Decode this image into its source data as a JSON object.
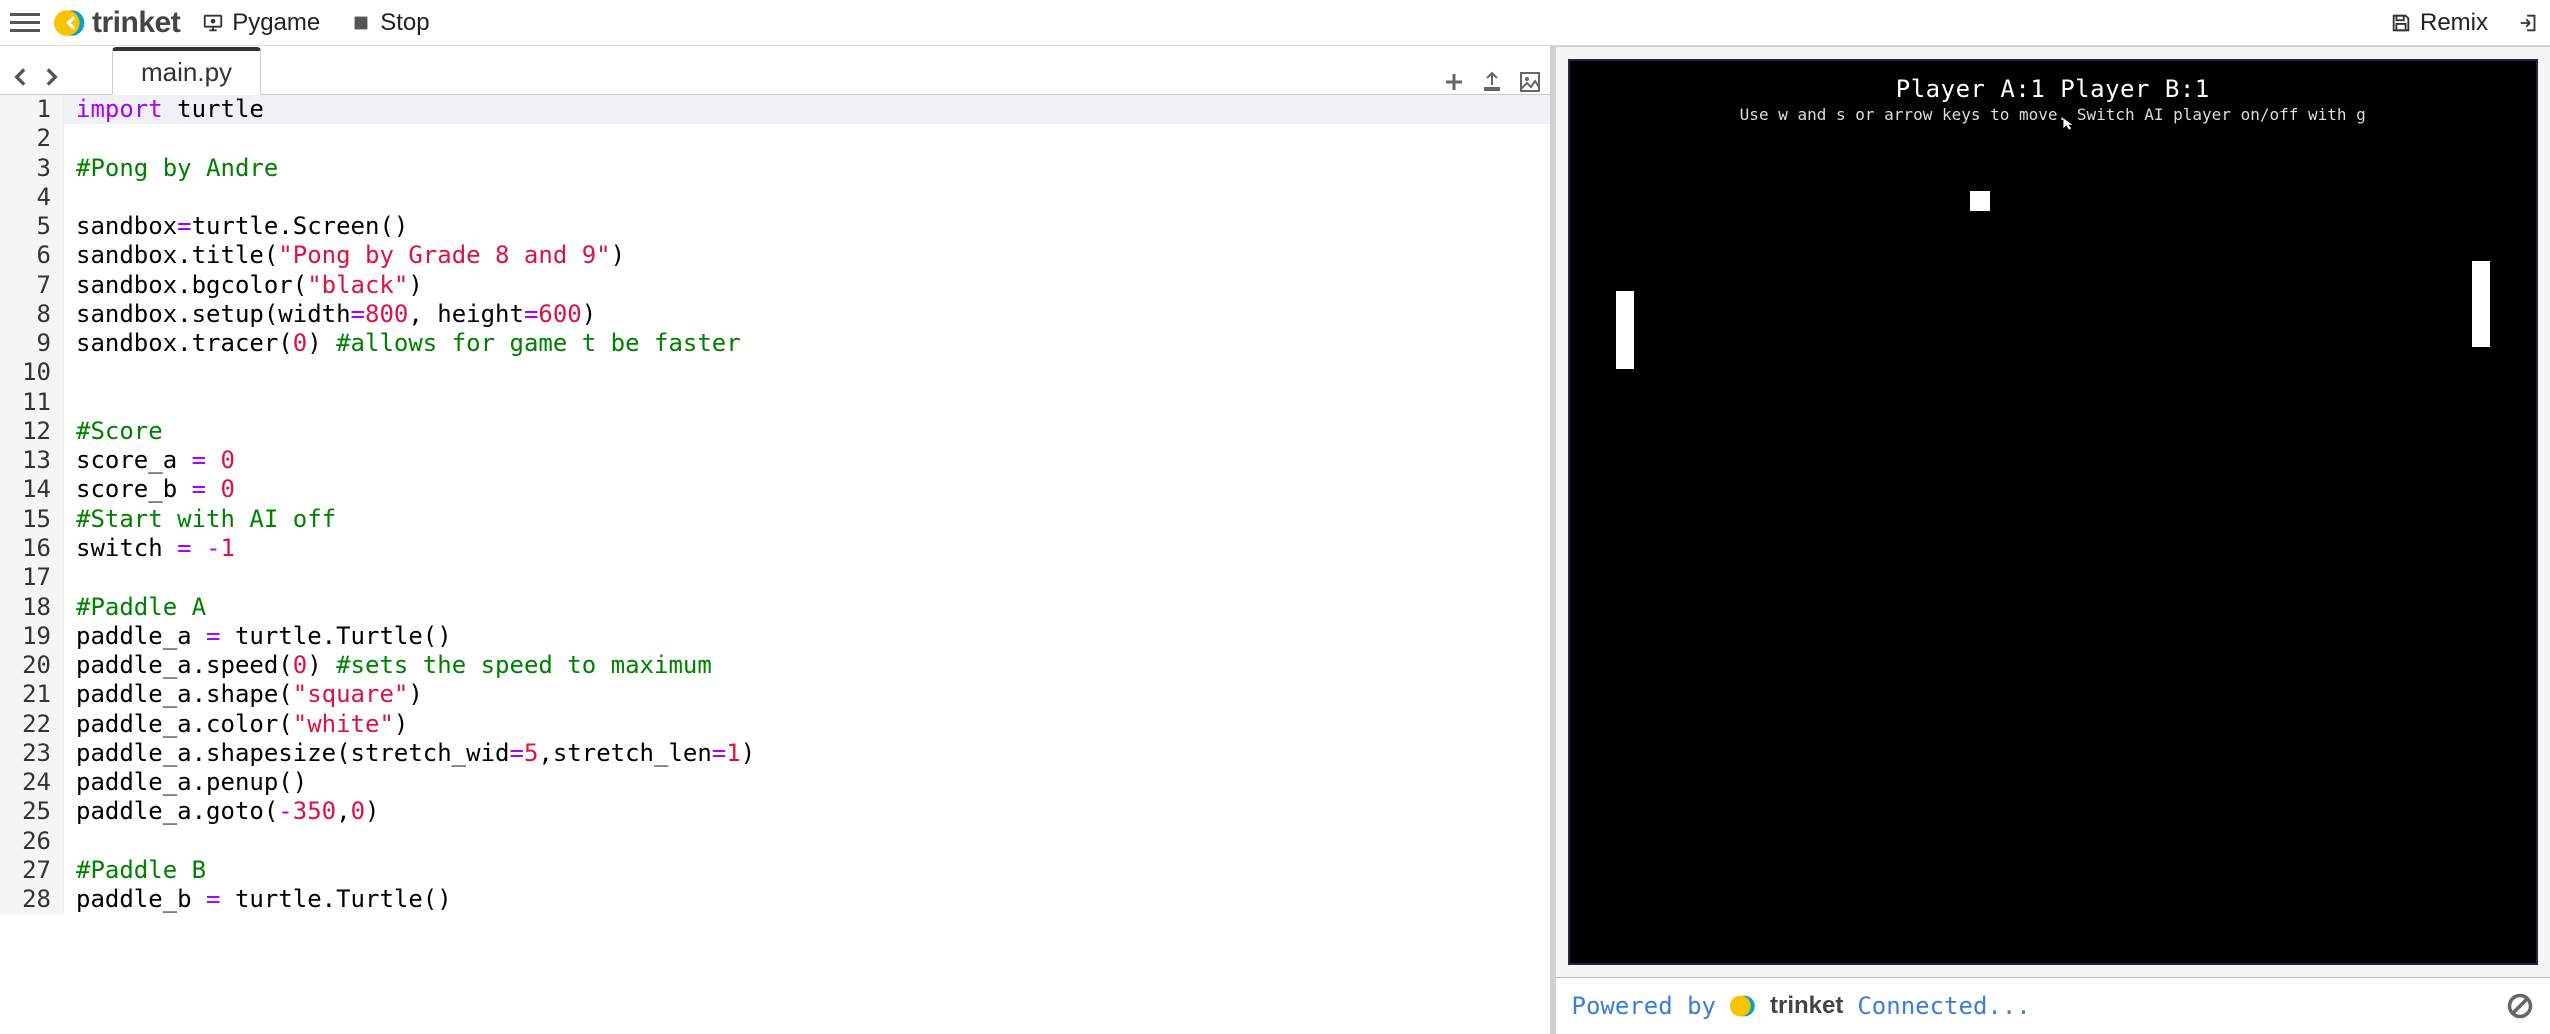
{
  "toolbar": {
    "brand": "trinket",
    "mode_label": "Pygame",
    "stop_label": "Stop",
    "remix_label": "Remix"
  },
  "editor": {
    "active_tab_filename": "main.py",
    "lines": [
      {
        "n": 1,
        "active": true,
        "tokens": [
          [
            "kw",
            "import"
          ],
          [
            "sp",
            " "
          ],
          [
            "nm",
            "turtle"
          ]
        ]
      },
      {
        "n": 2,
        "tokens": []
      },
      {
        "n": 3,
        "tokens": [
          [
            "com",
            "#Pong by Andre"
          ]
        ]
      },
      {
        "n": 4,
        "tokens": []
      },
      {
        "n": 5,
        "tokens": [
          [
            "nm",
            "sandbox"
          ],
          [
            "op",
            "="
          ],
          [
            "nm",
            "turtle.Screen()"
          ]
        ]
      },
      {
        "n": 6,
        "tokens": [
          [
            "nm",
            "sandbox.title("
          ],
          [
            "str",
            "\"Pong by Grade 8 and 9\""
          ],
          [
            "nm",
            ")"
          ]
        ]
      },
      {
        "n": 7,
        "tokens": [
          [
            "nm",
            "sandbox.bgcolor("
          ],
          [
            "str",
            "\"black\""
          ],
          [
            "nm",
            ")"
          ]
        ]
      },
      {
        "n": 8,
        "tokens": [
          [
            "nm",
            "sandbox.setup(width"
          ],
          [
            "op",
            "="
          ],
          [
            "num",
            "800"
          ],
          [
            "nm",
            ", height"
          ],
          [
            "op",
            "="
          ],
          [
            "num",
            "600"
          ],
          [
            "nm",
            ")"
          ]
        ]
      },
      {
        "n": 9,
        "tokens": [
          [
            "nm",
            "sandbox.tracer("
          ],
          [
            "num",
            "0"
          ],
          [
            "nm",
            ") "
          ],
          [
            "com",
            "#allows for game t be faster"
          ]
        ]
      },
      {
        "n": 10,
        "tokens": []
      },
      {
        "n": 11,
        "tokens": []
      },
      {
        "n": 12,
        "tokens": [
          [
            "com",
            "#Score"
          ]
        ]
      },
      {
        "n": 13,
        "tokens": [
          [
            "nm",
            "score_a "
          ],
          [
            "op",
            "="
          ],
          [
            "nm",
            " "
          ],
          [
            "num",
            "0"
          ]
        ]
      },
      {
        "n": 14,
        "tokens": [
          [
            "nm",
            "score_b "
          ],
          [
            "op",
            "="
          ],
          [
            "nm",
            " "
          ],
          [
            "num",
            "0"
          ]
        ]
      },
      {
        "n": 15,
        "tokens": [
          [
            "com",
            "#Start with AI off"
          ]
        ]
      },
      {
        "n": 16,
        "tokens": [
          [
            "nm",
            "switch "
          ],
          [
            "op",
            "="
          ],
          [
            "nm",
            " "
          ],
          [
            "op",
            "-"
          ],
          [
            "num",
            "1"
          ]
        ]
      },
      {
        "n": 17,
        "tokens": []
      },
      {
        "n": 18,
        "tokens": [
          [
            "com",
            "#Paddle A"
          ]
        ]
      },
      {
        "n": 19,
        "tokens": [
          [
            "nm",
            "paddle_a "
          ],
          [
            "op",
            "="
          ],
          [
            "nm",
            " turtle.Turtle()"
          ]
        ]
      },
      {
        "n": 20,
        "tokens": [
          [
            "nm",
            "paddle_a.speed("
          ],
          [
            "num",
            "0"
          ],
          [
            "nm",
            ") "
          ],
          [
            "com",
            "#sets the speed to maximum"
          ]
        ]
      },
      {
        "n": 21,
        "tokens": [
          [
            "nm",
            "paddle_a.shape("
          ],
          [
            "str",
            "\"square\""
          ],
          [
            "nm",
            ")"
          ]
        ]
      },
      {
        "n": 22,
        "tokens": [
          [
            "nm",
            "paddle_a.color("
          ],
          [
            "str",
            "\"white\""
          ],
          [
            "nm",
            ")"
          ]
        ]
      },
      {
        "n": 23,
        "tokens": [
          [
            "nm",
            "paddle_a.shapesize(stretch_wid"
          ],
          [
            "op",
            "="
          ],
          [
            "num",
            "5"
          ],
          [
            "nm",
            ",stretch_len"
          ],
          [
            "op",
            "="
          ],
          [
            "num",
            "1"
          ],
          [
            "nm",
            ")"
          ]
        ]
      },
      {
        "n": 24,
        "tokens": [
          [
            "nm",
            "paddle_a.penup()"
          ]
        ]
      },
      {
        "n": 25,
        "tokens": [
          [
            "nm",
            "paddle_a.goto("
          ],
          [
            "op",
            "-"
          ],
          [
            "num",
            "350"
          ],
          [
            "nm",
            ","
          ],
          [
            "num",
            "0"
          ],
          [
            "nm",
            ")"
          ]
        ]
      },
      {
        "n": 26,
        "tokens": []
      },
      {
        "n": 27,
        "tokens": [
          [
            "com",
            "#Paddle B"
          ]
        ]
      },
      {
        "n": 28,
        "tokens": [
          [
            "nm",
            "paddle_b "
          ],
          [
            "op",
            "="
          ],
          [
            "nm",
            " turtle.Turtle()"
          ]
        ]
      }
    ]
  },
  "game": {
    "score_a": 1,
    "score_b": 1,
    "score_text": "Player A:1  Player B:1",
    "help_text": "Use w and s or arrow keys to move. Switch AI player on/off with g"
  },
  "status": {
    "powered_by": "Powered by",
    "brand": "trinket",
    "connection_status": "Connected..."
  }
}
